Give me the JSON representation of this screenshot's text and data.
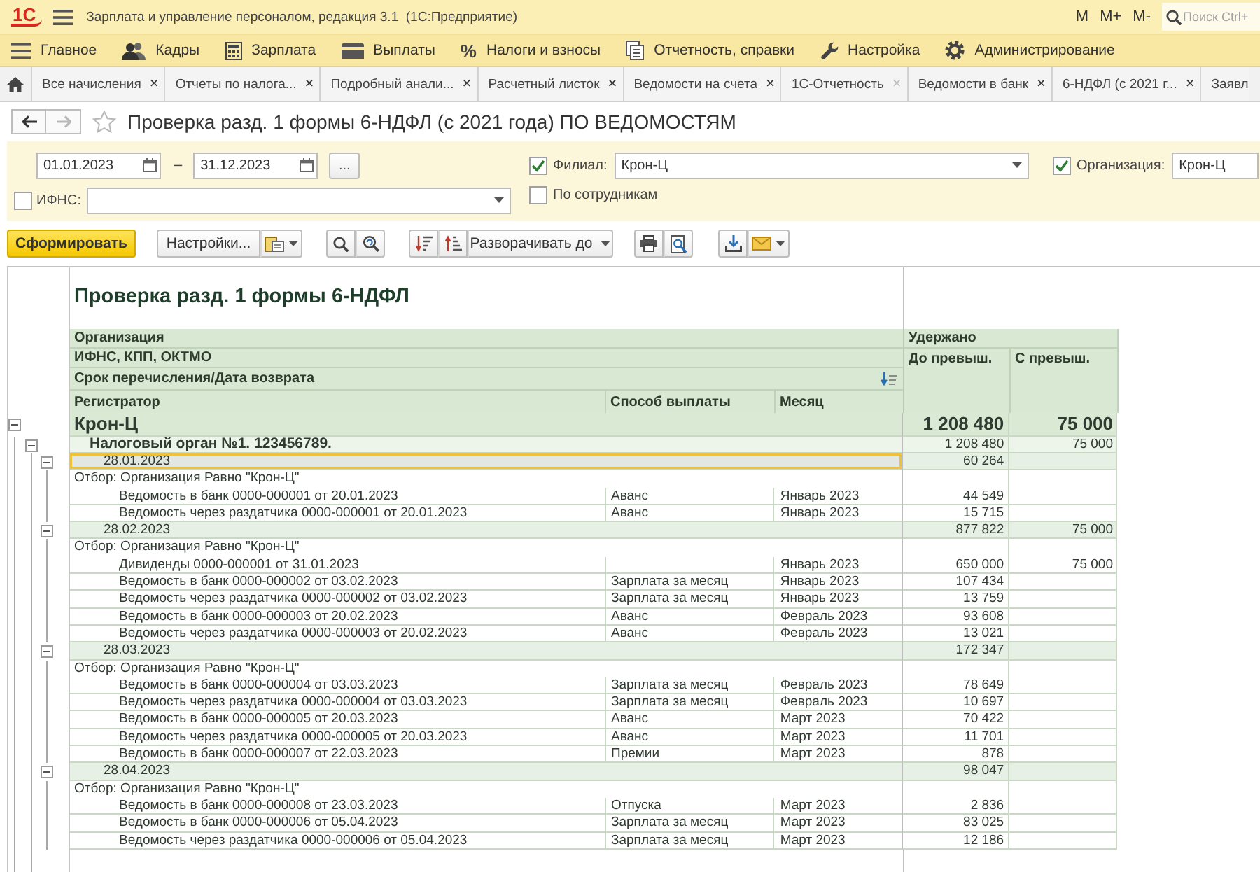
{
  "app": {
    "logo": "1С",
    "title": "Зарплата и управление персоналом, редакция 3.1  (1С:Предприятие)",
    "memory_buttons": [
      "M",
      "M+",
      "M-"
    ],
    "search": {
      "placeholder": "Поиск Ctrl+"
    }
  },
  "sections": [
    {
      "label": "Главное"
    },
    {
      "label": "Кадры"
    },
    {
      "label": "Зарплата"
    },
    {
      "label": "Выплаты"
    },
    {
      "label": "Налоги и взносы",
      "glyph": "%"
    },
    {
      "label": "Отчетность, справки"
    },
    {
      "label": "Настройка"
    },
    {
      "label": "Администрирование"
    }
  ],
  "tabs": [
    {
      "label": "Все начисления",
      "close": "×",
      "close_muted": false
    },
    {
      "label": "Отчеты по налога...",
      "close": "×",
      "close_muted": false
    },
    {
      "label": "Подробный анали...",
      "close": "×",
      "close_muted": false
    },
    {
      "label": "Расчетный листок",
      "close": "×",
      "close_muted": false
    },
    {
      "label": "Ведомости на счета",
      "close": "×",
      "close_muted": false
    },
    {
      "label": "1С-Отчетность",
      "close": "×",
      "close_muted": true
    },
    {
      "label": "Ведомости в банк",
      "close": "×",
      "close_muted": false
    },
    {
      "label": "6-НДФЛ (с 2021 г...",
      "close": "×",
      "close_muted": false
    },
    {
      "label": "Заявл"
    }
  ],
  "form": {
    "title": "Проверка разд. 1 формы 6-НДФЛ (с 2021 года) ПО ВЕДОМОСТЯМ",
    "favorite": false,
    "nav": {
      "back_disabled": false,
      "forward_disabled": true
    }
  },
  "filters": {
    "period": {
      "from": "01.01.2023",
      "separator": "–",
      "to": "31.12.2023",
      "choose_button": "..."
    },
    "ifns": {
      "checked": false,
      "label": "ИФНС:"
    },
    "branch": {
      "checked": true,
      "label": "Филиал:",
      "value": "Крон-Ц"
    },
    "by_employees": {
      "checked": false,
      "label": "По сотрудникам"
    },
    "organization": {
      "checked": true,
      "label": "Организация:",
      "value": "Крон-Ц"
    }
  },
  "toolbar": {
    "generate": "Сформировать",
    "settings": "Настройки...",
    "expand_to": "Разворачивать до"
  },
  "report": {
    "title": "Проверка разд. 1 формы 6-НДФЛ",
    "header": {
      "group_levels": [
        "Организация",
        "ИФНС, КПП, ОКТМО",
        "Срок перечисления/Дата возврата"
      ],
      "columns": [
        "Регистратор",
        "Способ выплаты",
        "Месяц"
      ],
      "withheld": "Удержано",
      "withheld_columns": [
        "До превыш.",
        "С превыш."
      ]
    },
    "groups": [
      {
        "kind": "organization",
        "name": "Крон-Ц",
        "before": "1 208 480",
        "over": "75 000",
        "expanded": true,
        "children": [
          {
            "kind": "tax_office",
            "name": "Налоговый орган №1. 123456789.",
            "before": "1 208 480",
            "over": "75 000",
            "expanded": true,
            "children": [
              {
                "kind": "period",
                "name": "28.01.2023",
                "before": "60 264",
                "expanded": true,
                "selected": true,
                "filter": "Отбор: Организация Равно \"Крон-Ц\"",
                "children": [
                  {
                    "kind": "record",
                    "registrar": "Ведомость в банк 0000-000001 от 20.01.2023",
                    "payment_method": "Аванс",
                    "month": "Январь 2023",
                    "before": "44 549"
                  },
                  {
                    "kind": "record",
                    "registrar": "Ведомость через раздатчика 0000-000001 от 20.01.2023",
                    "payment_method": "Аванс",
                    "month": "Январь 2023",
                    "before": "15 715"
                  }
                ]
              },
              {
                "kind": "period",
                "name": "28.02.2023",
                "before": "877 822",
                "over": "75 000",
                "expanded": true,
                "selected": false,
                "filter": "Отбор: Организация Равно \"Крон-Ц\"",
                "children": [
                  {
                    "kind": "record",
                    "registrar": "Дивиденды 0000-000001 от 31.01.2023",
                    "month": "Январь 2023",
                    "before": "650 000",
                    "over": "75 000"
                  },
                  {
                    "kind": "record",
                    "registrar": "Ведомость в банк 0000-000002 от 03.02.2023",
                    "payment_method": "Зарплата за месяц",
                    "month": "Январь 2023",
                    "before": "107 434"
                  },
                  {
                    "kind": "record",
                    "registrar": "Ведомость через раздатчика 0000-000002 от 03.02.2023",
                    "payment_method": "Зарплата за месяц",
                    "month": "Январь 2023",
                    "before": "13 759"
                  },
                  {
                    "kind": "record",
                    "registrar": "Ведомость в банк 0000-000003 от 20.02.2023",
                    "payment_method": "Аванс",
                    "month": "Февраль 2023",
                    "before": "93 608"
                  },
                  {
                    "kind": "record",
                    "registrar": "Ведомость через раздатчика 0000-000003 от 20.02.2023",
                    "payment_method": "Аванс",
                    "month": "Февраль 2023",
                    "before": "13 021"
                  }
                ]
              },
              {
                "kind": "period",
                "name": "28.03.2023",
                "before": "172 347",
                "expanded": true,
                "selected": false,
                "filter": "Отбор: Организация Равно \"Крон-Ц\"",
                "children": [
                  {
                    "kind": "record",
                    "registrar": "Ведомость в банк 0000-000004 от 03.03.2023",
                    "payment_method": "Зарплата за месяц",
                    "month": "Февраль 2023",
                    "before": "78 649"
                  },
                  {
                    "kind": "record",
                    "registrar": "Ведомость через раздатчика 0000-000004 от 03.03.2023",
                    "payment_method": "Зарплата за месяц",
                    "month": "Февраль 2023",
                    "before": "10 697"
                  },
                  {
                    "kind": "record",
                    "registrar": "Ведомость в банк 0000-000005 от 20.03.2023",
                    "payment_method": "Аванс",
                    "month": "Март 2023",
                    "before": "70 422"
                  },
                  {
                    "kind": "record",
                    "registrar": "Ведомость через раздатчика 0000-000005 от 20.03.2023",
                    "payment_method": "Аванс",
                    "month": "Март 2023",
                    "before": "11 701"
                  },
                  {
                    "kind": "record",
                    "registrar": "Ведомость в банк 0000-000007 от 22.03.2023",
                    "payment_method": "Премии",
                    "month": "Март 2023",
                    "before": "878"
                  }
                ]
              },
              {
                "kind": "period",
                "name": "28.04.2023",
                "before": "98 047",
                "expanded": true,
                "selected": false,
                "filter": "Отбор: Организация Равно \"Крон-Ц\"",
                "children": [
                  {
                    "kind": "record",
                    "registrar": "Ведомость в банк 0000-000008 от 23.03.2023",
                    "payment_method": "Отпуска",
                    "month": "Март 2023",
                    "before": "2 836"
                  },
                  {
                    "kind": "record",
                    "registrar": "Ведомость в банк 0000-000006 от 05.04.2023",
                    "payment_method": "Зарплата за месяц",
                    "month": "Март 2023",
                    "before": "83 025"
                  },
                  {
                    "kind": "record",
                    "registrar": "Ведомость через раздатчика 0000-000006 от 05.04.2023",
                    "payment_method": "Зарплата за месяц",
                    "month": "Март 2023",
                    "before": "12 186"
                  }
                ]
              }
            ]
          }
        ]
      }
    ]
  }
}
